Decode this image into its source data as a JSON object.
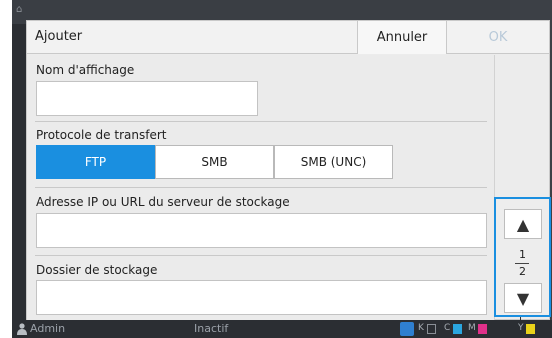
{
  "dialog": {
    "title": "Ajouter",
    "cancel_label": "Annuler",
    "ok_label": "OK"
  },
  "form": {
    "display_name_label": "Nom d'affichage",
    "display_name_value": "",
    "protocol_label": "Protocole de transfert",
    "protocol_options": [
      "FTP",
      "SMB",
      "SMB (UNC)"
    ],
    "protocol_selected": "FTP",
    "server_label": "Adresse IP ou URL du serveur de stockage",
    "server_value": "",
    "folder_label": "Dossier de stockage",
    "folder_value": ""
  },
  "pager": {
    "current_page": "1",
    "total_pages": "2",
    "up_icon": "triangle-up-icon",
    "down_icon": "triangle-down-icon"
  },
  "status_bar": {
    "user_label": "Admin",
    "state_label": "Inactif",
    "ink_labels": [
      "K",
      "C",
      "M",
      "Y"
    ]
  },
  "colors": {
    "accent": "#1a8fe0",
    "ink_k": "#555555",
    "ink_c": "#2aa6df",
    "ink_m": "#e0308a",
    "ink_y": "#e9d21a"
  }
}
